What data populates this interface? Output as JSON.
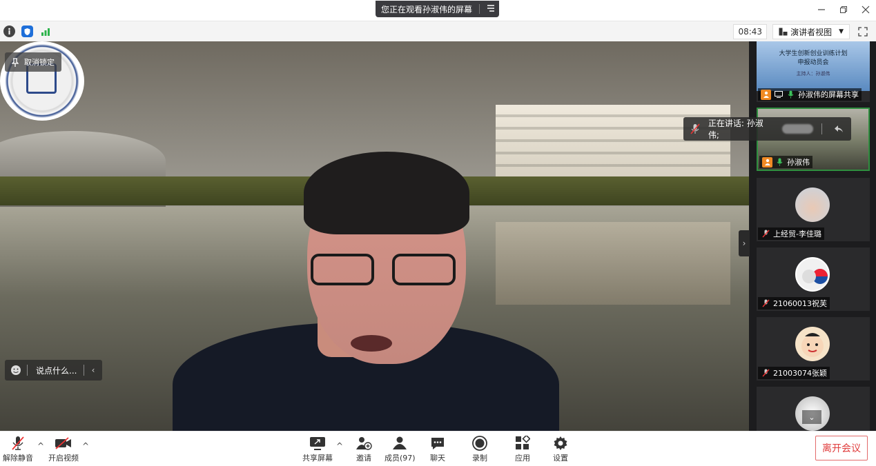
{
  "titlebar": {
    "banner_text": "您正在观看孙淑伟的屏幕",
    "banner_menu_icon": "list-icon",
    "minimize_icon": "minimize-icon",
    "restore_icon": "restore-icon",
    "close_icon": "close-icon"
  },
  "toolbar": {
    "info_icon": "info-icon",
    "shield_icon": "shield-icon",
    "signal_icon": "signal-icon",
    "clock": "08:43",
    "view_label": "演讲者视图",
    "fullscreen_icon": "fullscreen-icon"
  },
  "main_video": {
    "unpin_label": "取消锁定",
    "chat_placeholder": "说点什么...",
    "speaking_label": "正在讲话: 孙淑伟;",
    "colors": {
      "overlay": "#3c3c3c",
      "speaker_border": "#2f8f3f"
    }
  },
  "sidebar": {
    "tiles": [
      {
        "label": "孙淑伟的屏幕共享",
        "slide_title_1": "大学生创新创业训练计划",
        "slide_title_2": "申报动员会",
        "slide_subtitle": "主持人：孙淑伟"
      },
      {
        "label": "孙淑伟"
      },
      {
        "label": "上经贸-李佳璐"
      },
      {
        "label": "21060013祝芙"
      },
      {
        "label": "21003074张颖"
      },
      {
        "label": ""
      }
    ]
  },
  "bottombar": {
    "unmute": "解除静音",
    "start_video": "开启视频",
    "share_screen": "共享屏幕",
    "invite": "邀请",
    "members": "成员(97)",
    "chat": "聊天",
    "record": "录制",
    "apps": "应用",
    "settings": "设置",
    "leave": "离开会议",
    "leave_color": "#e03b3b"
  }
}
